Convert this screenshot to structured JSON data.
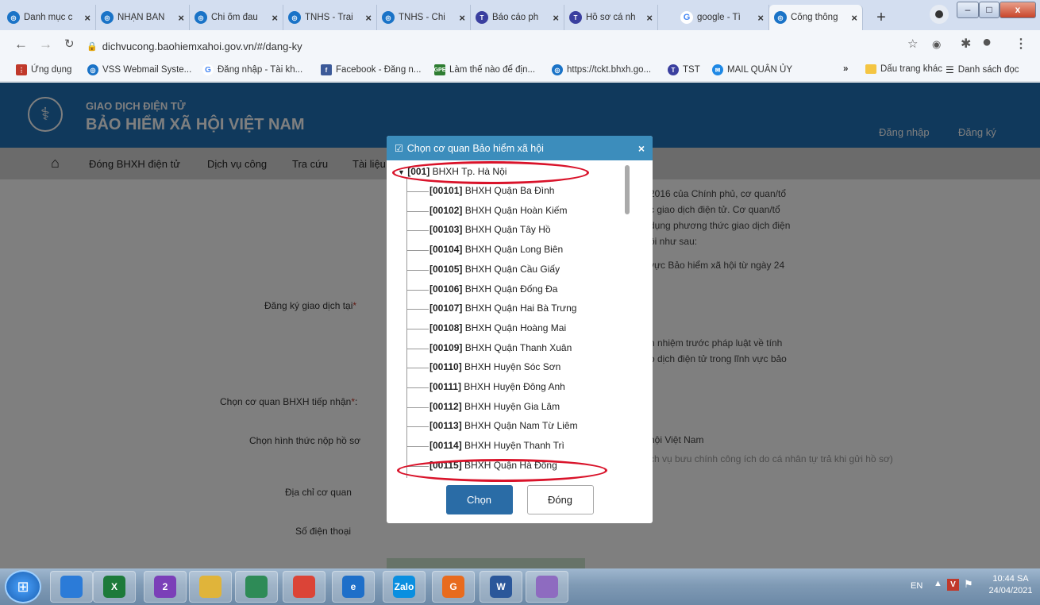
{
  "browser": {
    "tabs": [
      {
        "label": "Danh mục c",
        "icon": "vss-icon",
        "color": "#1a73c7"
      },
      {
        "label": "NHẬN BÀN",
        "icon": "vss-icon",
        "color": "#1a73c7"
      },
      {
        "label": "Chi ốm đau",
        "icon": "vss-icon",
        "color": "#1a73c7"
      },
      {
        "label": "TNHS - Trai",
        "icon": "vss-icon",
        "color": "#1a73c7"
      },
      {
        "label": "TNHS - Chi",
        "icon": "vss-icon",
        "color": "#1a73c7"
      },
      {
        "label": "Báo cáo ph",
        "icon": "tst-icon",
        "color": "#3a3f9f"
      },
      {
        "label": "Hồ sơ cá nh",
        "icon": "tst-icon",
        "color": "#3a3f9f"
      },
      {
        "label": "google - Tì",
        "icon": "google-icon",
        "color": "#4285f4"
      },
      {
        "label": "Cổng thông",
        "icon": "vss-icon",
        "color": "#1a73c7"
      }
    ],
    "new_tab": "+",
    "window_controls": {
      "minimize": "–",
      "maximize": "□",
      "close": "x"
    },
    "url": "dichvucong.baohiemxahoi.gov.vn/#/dang-ky",
    "bookmarks": [
      {
        "label": "Ứng dụng",
        "icon": "apps-icon",
        "color": "#c0392b"
      },
      {
        "label": "VSS Webmail Syste...",
        "icon": "vss-icon",
        "color": "#1a73c7"
      },
      {
        "label": "Đăng nhập - Tài kh...",
        "icon": "google-icon",
        "color": "#4285f4"
      },
      {
        "label": "Facebook - Đăng n...",
        "icon": "facebook-icon",
        "color": "#3b5998"
      },
      {
        "label": "Làm thế nào để địn...",
        "icon": "gpe-icon",
        "color": "#2e7d32"
      },
      {
        "label": "https://tckt.bhxh.go...",
        "icon": "vss-icon",
        "color": "#1a73c7"
      },
      {
        "label": "TST",
        "icon": "tst-icon",
        "color": "#3a3f9f"
      },
      {
        "label": "MAIL QUÂN ỦY",
        "icon": "mail-icon",
        "color": "#1e88e5"
      }
    ],
    "bookmarks_more": "»",
    "bookmarks_other": "Dấu trang khác",
    "reading_list": "Danh sách đọc"
  },
  "site": {
    "title_top": "GIAO DỊCH ĐIỆN TỬ",
    "title_main": "BẢO HIỂM XÃ HỘI VIỆT NAM",
    "login": "Đăng nhập",
    "register": "Đăng ký",
    "menu": [
      "Đóng BHXH điện tử",
      "Dịch vụ công",
      "Tra cứu",
      "Tài liệu"
    ]
  },
  "form": {
    "label_register_at": "Đăng ký giao dịch tại",
    "label_agency": "Chọn cơ quan BHXH tiếp nhận",
    "label_submit_method": "Chọn hình thức nộp hồ sơ",
    "label_address": "Địa chỉ cơ quan",
    "label_phone": "Số điện thoại",
    "required_mark": "*",
    "para1": [
      "2016 của Chính phủ, cơ quan/tổ",
      "c giao dịch điện tử. Cơ quan/tổ",
      "dụng phương thức giao dịch điện",
      "ội như sau:"
    ],
    "para2": "vực Bảo hiểm xã hội từ ngày 24",
    "para3": [
      "n nhiệm trước pháp luật về tính",
      "o dịch điện tử trong lĩnh vực bảo"
    ],
    "method1": "hội Việt Nam",
    "method2": "ch vụ bưu chính công ích do cá nhân tự trả khi gửi hồ sơ)"
  },
  "modal": {
    "title": "Chọn cơ quan Bảo hiểm xã hội",
    "close": "×",
    "root_code": "[001]",
    "root_name": "BHXH Tp. Hà Nội",
    "items": [
      {
        "code": "[00101]",
        "name": "BHXH Quận Ba Đình"
      },
      {
        "code": "[00102]",
        "name": "BHXH Quận Hoàn Kiếm"
      },
      {
        "code": "[00103]",
        "name": "BHXH Quận Tây Hồ"
      },
      {
        "code": "[00104]",
        "name": "BHXH Quận Long Biên"
      },
      {
        "code": "[00105]",
        "name": "BHXH Quận Cầu Giấy"
      },
      {
        "code": "[00106]",
        "name": "BHXH Quận Đống Đa"
      },
      {
        "code": "[00107]",
        "name": "BHXH Quận Hai Bà Trưng"
      },
      {
        "code": "[00108]",
        "name": "BHXH Quận Hoàng Mai"
      },
      {
        "code": "[00109]",
        "name": "BHXH Quận Thanh Xuân"
      },
      {
        "code": "[00110]",
        "name": "BHXH Huyện Sóc Sơn"
      },
      {
        "code": "[00111]",
        "name": "BHXH Huyện Đông Anh"
      },
      {
        "code": "[00112]",
        "name": "BHXH Huyện Gia Lâm"
      },
      {
        "code": "[00113]",
        "name": "BHXH Quận Nam Từ Liêm"
      },
      {
        "code": "[00114]",
        "name": "BHXH Huyện Thanh Trì"
      },
      {
        "code": "[00115]",
        "name": "BHXH Quận Hà Đông"
      }
    ],
    "btn_select": "Chọn",
    "btn_close": "Đóng"
  },
  "taskbar": {
    "apps": [
      {
        "name": "chrome-icon",
        "color": "#2b7bd8",
        "label": ""
      },
      {
        "name": "excel-icon",
        "color": "#1d7a3a",
        "label": "X"
      },
      {
        "name": "viber-icon",
        "color": "#7b3fb8",
        "label": "2"
      },
      {
        "name": "file-explorer-icon",
        "color": "#e0b43a",
        "label": ""
      },
      {
        "name": "app-icon",
        "color": "#2e8b57",
        "label": ""
      },
      {
        "name": "chrome-icon",
        "color": "#db4437",
        "label": ""
      },
      {
        "name": "ie-icon",
        "color": "#1e6fc9",
        "label": "e"
      },
      {
        "name": "zalo-icon",
        "color": "#0a8fe0",
        "label": "Zalo"
      },
      {
        "name": "foxit-icon",
        "color": "#e86b1e",
        "label": "G"
      },
      {
        "name": "word-icon",
        "color": "#2b579a",
        "label": "W"
      },
      {
        "name": "paint-icon",
        "color": "#8e6bc0",
        "label": ""
      }
    ],
    "lang": "EN",
    "time": "10:44 SA",
    "date": "24/04/2021"
  }
}
